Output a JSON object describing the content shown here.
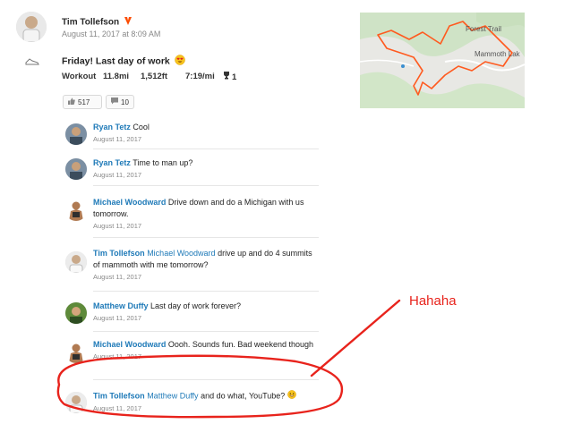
{
  "activity": {
    "athlete_name": "Tim Tollefson",
    "badge_icon": "subscriber-badge-icon",
    "timestamp": "August 11, 2017 at 8:09 AM",
    "sport_icon": "shoe-icon",
    "title": "Friday! Last day of work",
    "title_emoji": "heart-eyes-emoji",
    "stats": {
      "type_label": "Workout",
      "distance": "11.8mi",
      "elevation": "1,512ft",
      "pace": "7:19/mi",
      "achievements": "1"
    },
    "kudos_count": "517",
    "comments_count": "10"
  },
  "map": {
    "label_top": "Forest Trail",
    "label_right": "Mammoth Lak",
    "route_color": "#ff5a1f"
  },
  "comments": [
    {
      "author": "Ryan Tetz",
      "mention": "",
      "text": "Cool",
      "date": "August 11, 2017"
    },
    {
      "author": "Ryan Tetz",
      "mention": "",
      "text": "Time to man up?",
      "date": "August 11, 2017"
    },
    {
      "author": "Michael Woodward",
      "mention": "",
      "text": "Drive down and do a Michigan with us tomorrow.",
      "date": "August 11, 2017"
    },
    {
      "author": "Tim Tollefson",
      "mention": "Michael Woodward",
      "text": "drive up and do 4 summits of mammoth with me tomorrow?",
      "date": "August 11, 2017"
    },
    {
      "author": "Matthew Duffy",
      "mention": "",
      "text": "Last day of work forever?",
      "date": "August 11, 2017"
    },
    {
      "author": "Michael Woodward",
      "mention": "",
      "text": "Oooh. Sounds fun. Bad weekend though",
      "date": "August 11, 2017"
    },
    {
      "author": "Tim Tollefson",
      "mention": "Matthew Duffy",
      "text": "and do what, YouTube?",
      "date": "August 11, 2017"
    }
  ],
  "annotation": {
    "text": "Hahaha",
    "color": "#e8231c"
  }
}
